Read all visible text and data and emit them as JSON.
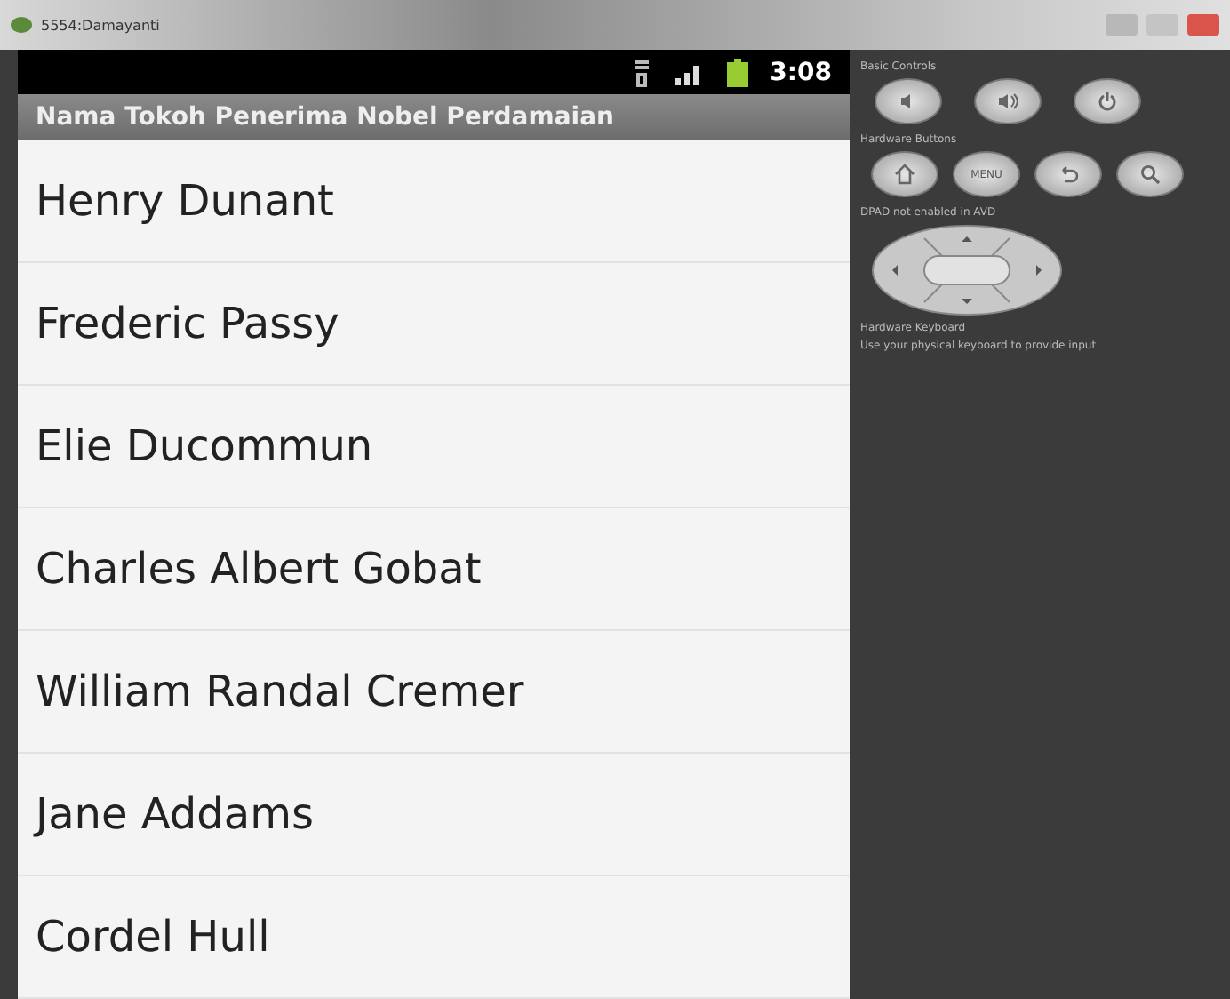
{
  "window": {
    "title": "5554:Damayanti"
  },
  "status_bar": {
    "time": "3:08"
  },
  "app_title": "Nama Tokoh Penerima Nobel Perdamaian",
  "items": [
    "Henry Dunant",
    "Frederic Passy",
    "Elie Ducommun",
    "Charles Albert Gobat",
    "William Randal Cremer",
    "Jane Addams",
    "Cordel Hull"
  ],
  "controls": {
    "basic_label": "Basic Controls",
    "basic_buttons": [
      {
        "kind": "voldown"
      },
      {
        "kind": "volup"
      },
      {
        "kind": "power"
      }
    ],
    "hardware_label": "Hardware Buttons",
    "hardware_buttons": [
      {
        "kind": "home"
      },
      {
        "kind": "menu",
        "label": "MENU"
      },
      {
        "kind": "back"
      },
      {
        "kind": "search"
      }
    ],
    "dpad_label": "DPAD not enabled in AVD",
    "keyboard_label": "Hardware Keyboard",
    "keyboard_hint": "Use your physical keyboard to provide input"
  }
}
